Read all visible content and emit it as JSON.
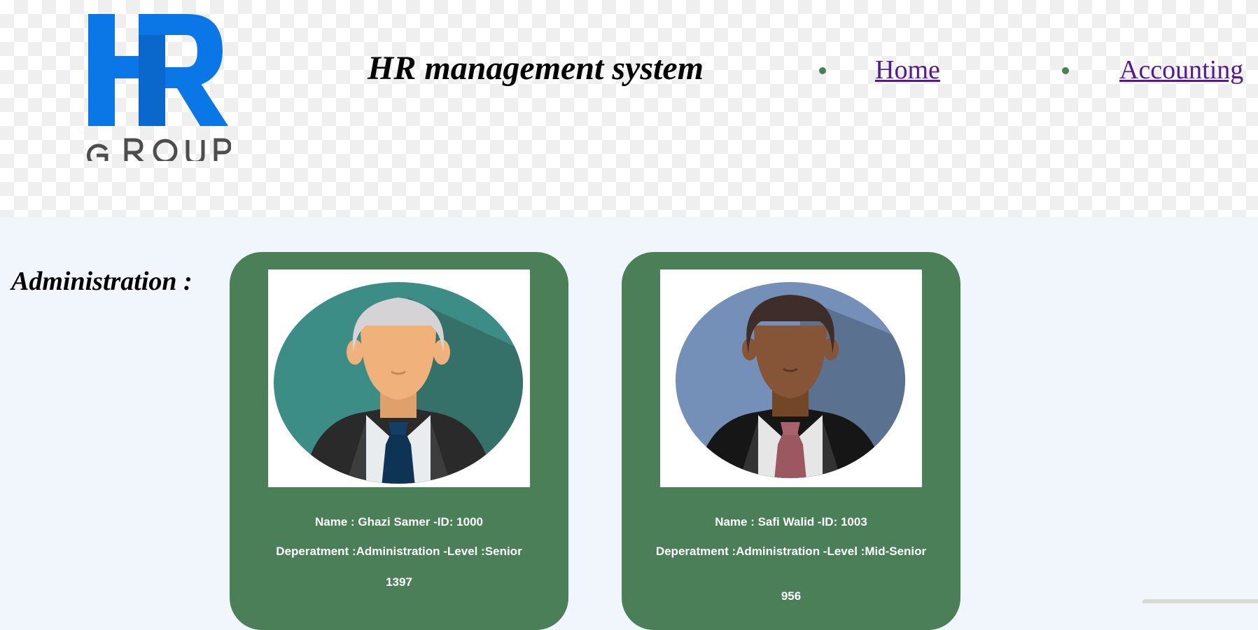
{
  "header": {
    "logo_letters": "HR",
    "logo_word": "GROUP",
    "title": "HR management system",
    "nav": [
      {
        "label": "Home"
      },
      {
        "label": "Accounting"
      }
    ]
  },
  "section": {
    "label": "Administration :"
  },
  "employees": [
    {
      "name_line": "Name : Ghazi Samer -ID: 1000",
      "dept_line": "Deperatment :Administration -Level :Senior",
      "number": "1397"
    },
    {
      "name_line": "Name : Safi Walid -ID: 1003",
      "dept_line": "Deperatment :Administration -Level :Mid-Senior",
      "number": "956"
    }
  ],
  "colors": {
    "card": "#4a7f57",
    "page_bg": "#f0f6fc",
    "link": "#551a8b",
    "logo_blue": "#0b76e6",
    "logo_gray": "#4d4d4d"
  },
  "icons": {
    "avatar_1": "avatar-elder-man-icon",
    "avatar_2": "avatar-young-man-icon"
  }
}
